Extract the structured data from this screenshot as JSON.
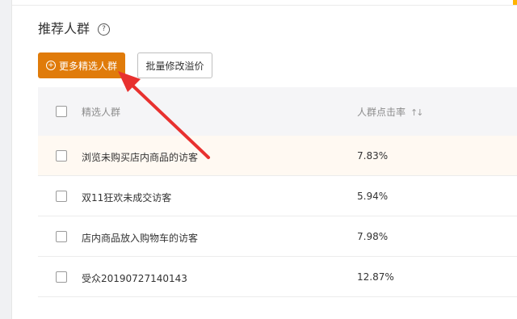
{
  "section": {
    "title": "推荐人群",
    "help_icon": "?"
  },
  "toolbar": {
    "primary_icon": "+",
    "primary_label": "更多精选人群",
    "secondary_label": "批量修改溢价"
  },
  "table": {
    "columns": {
      "name": "精选人群",
      "rate": "人群点击率",
      "sort_icon": "↑↓"
    },
    "rows": [
      {
        "name": "浏览未购买店内商品的访客",
        "rate": "7.83%"
      },
      {
        "name": "双11狂欢未成交访客",
        "rate": "5.94%"
      },
      {
        "name": "店内商品放入购物车的访客",
        "rate": "7.98%"
      },
      {
        "name": "受众20190727140143",
        "rate": "12.87%"
      }
    ]
  },
  "colors": {
    "accent": "#e07b0a",
    "annotation_arrow": "#e8312f"
  }
}
